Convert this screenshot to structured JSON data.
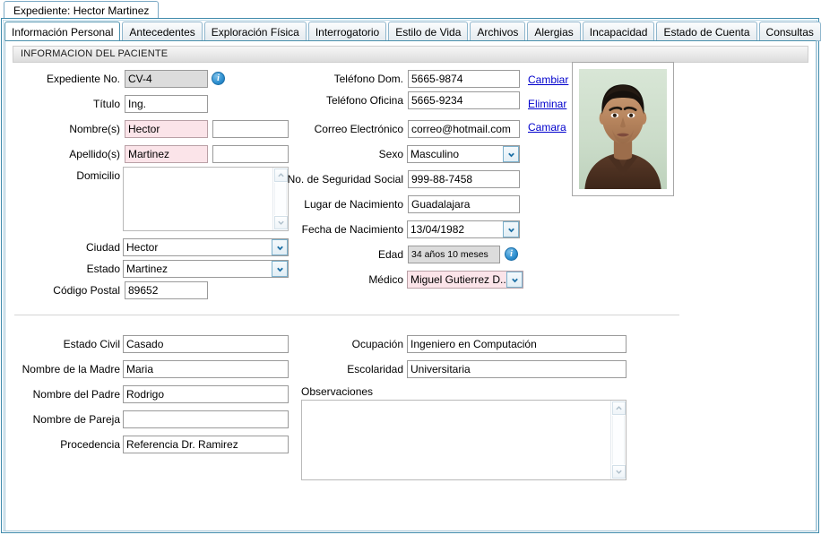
{
  "window": {
    "document_tab_label": "Expediente: Hector Martinez"
  },
  "tabs": [
    {
      "label": "Información Personal",
      "active": true
    },
    {
      "label": "Antecedentes",
      "active": false
    },
    {
      "label": "Exploración Física",
      "active": false
    },
    {
      "label": "Interrogatorio",
      "active": false
    },
    {
      "label": "Estilo de Vida",
      "active": false
    },
    {
      "label": "Archivos",
      "active": false
    },
    {
      "label": "Alergias",
      "active": false
    },
    {
      "label": "Incapacidad",
      "active": false
    },
    {
      "label": "Estado de Cuenta",
      "active": false
    },
    {
      "label": "Consultas",
      "active": false
    }
  ],
  "section": {
    "title": "INFORMACION DEL PACIENTE"
  },
  "form": {
    "expediente_no": {
      "label": "Expediente No.",
      "value": "CV-4"
    },
    "titulo": {
      "label": "Título",
      "value": "Ing."
    },
    "nombres": {
      "label": "Nombre(s)",
      "value": "Hector",
      "secondary_value": ""
    },
    "apellidos": {
      "label": "Apellido(s)",
      "value": "Martinez",
      "secondary_value": ""
    },
    "domicilio": {
      "label": "Domicilio",
      "value": ""
    },
    "ciudad": {
      "label": "Ciudad",
      "value": "Hector"
    },
    "estado": {
      "label": "Estado",
      "value": "Martinez"
    },
    "codigo_postal": {
      "label": "Código Postal",
      "value": "89652"
    },
    "telefono_dom": {
      "label": "Teléfono Dom.",
      "value": "5665-9874"
    },
    "telefono_oficina": {
      "label": "Teléfono Oficina",
      "value": "5665-9234"
    },
    "correo": {
      "label": "Correo Electrónico",
      "value": "correo@hotmail.com"
    },
    "sexo": {
      "label": "Sexo",
      "value": "Masculino"
    },
    "seguridad_social": {
      "label": "No. de Seguridad Social",
      "value": "999-88-7458"
    },
    "lugar_nacimiento": {
      "label": "Lugar de Nacimiento",
      "value": "Guadalajara"
    },
    "fecha_nacimiento": {
      "label": "Fecha de Nacimiento",
      "value": "13/04/1982"
    },
    "edad": {
      "label": "Edad",
      "value": "34 años 10 meses"
    },
    "medico": {
      "label": "Médico",
      "value": "Miguel Gutierrez D..."
    },
    "estado_civil": {
      "label": "Estado Civil",
      "value": "Casado"
    },
    "nombre_madre": {
      "label": "Nombre de la Madre",
      "value": "Maria"
    },
    "nombre_padre": {
      "label": "Nombre del Padre",
      "value": "Rodrigo"
    },
    "nombre_pareja": {
      "label": "Nombre de Pareja",
      "value": ""
    },
    "procedencia": {
      "label": "Procedencia",
      "value": "Referencia Dr. Ramirez"
    },
    "ocupacion": {
      "label": "Ocupación",
      "value": "Ingeniero en Computación"
    },
    "escolaridad": {
      "label": "Escolaridad",
      "value": "Universitaria"
    },
    "observaciones": {
      "label": "Observaciones",
      "value": ""
    }
  },
  "photo_actions": [
    {
      "label": "Cambiar"
    },
    {
      "label": "Eliminar"
    },
    {
      "label": "Camara"
    }
  ],
  "icons": {
    "info": "i"
  },
  "colors": {
    "accent_border": "#3f8aab",
    "tab_active_border": "#4a90ac",
    "required_field_bg": "#fbe4e9",
    "readonly_field_bg": "#dcdcdc",
    "link": "#0000cc"
  }
}
